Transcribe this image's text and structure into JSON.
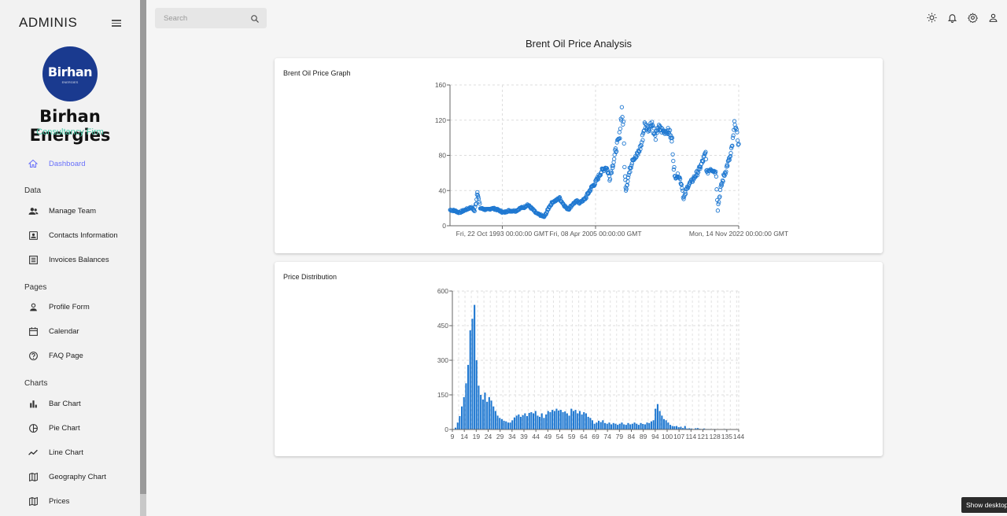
{
  "sidebar": {
    "brand": "ADMINIS",
    "logo_text": "Birhan",
    "logo_sub": "ENERGIES",
    "company_name": "Birhan Energies",
    "company_sub": "Consultancy Firm",
    "dashboard": {
      "label": "Dashboard",
      "icon": "home-icon"
    },
    "sections": {
      "data": "Data",
      "pages": "Pages",
      "charts": "Charts"
    },
    "items": {
      "manage_team": {
        "label": "Manage Team",
        "icon": "people-icon"
      },
      "contacts": {
        "label": "Contacts Information",
        "icon": "contacts-icon"
      },
      "invoices": {
        "label": "Invoices Balances",
        "icon": "receipt-icon"
      },
      "profile": {
        "label": "Profile Form",
        "icon": "person-icon"
      },
      "calendar": {
        "label": "Calendar",
        "icon": "calendar-icon"
      },
      "faq": {
        "label": "FAQ Page",
        "icon": "help-icon"
      },
      "bar": {
        "label": "Bar Chart",
        "icon": "bar-chart-icon"
      },
      "pie": {
        "label": "Pie Chart",
        "icon": "pie-chart-icon"
      },
      "line": {
        "label": "Line Chart",
        "icon": "line-chart-icon"
      },
      "geo": {
        "label": "Geography Chart",
        "icon": "map-icon"
      },
      "prices": {
        "label": "Prices",
        "icon": "map-icon"
      }
    }
  },
  "topbar": {
    "search_placeholder": "Search"
  },
  "page": {
    "title": "Brent Oil Price Analysis"
  },
  "taskbar": {
    "show_desktop": "Show desktop"
  },
  "colors": {
    "accent": "#6870fa",
    "brand_green": "#4cceac",
    "series": "#1f78d1",
    "logo_bg": "#1a3a8f"
  },
  "chart_data": [
    {
      "type": "scatter",
      "title": "Brent Oil Price Graph",
      "x_tick_labels": [
        "Fri, 22 Oct 1993 00:00:00 GMT",
        "Fri, 08 Apr 2005 00:00:00 GMT",
        "Mon, 14 Nov 2022 00:00:00 GMT"
      ],
      "x_ticks": [
        1993.81,
        2005.27,
        2022.87
      ],
      "xlim": [
        1987.38,
        2022.87
      ],
      "ylim": [
        0,
        160
      ],
      "y_ticks": [
        0,
        40,
        80,
        120,
        160
      ],
      "grid": true,
      "series": [
        {
          "x": [
            1987.4,
            1988.0,
            1988.5,
            1989.0,
            1989.5,
            1990.0,
            1990.4,
            1990.6,
            1990.75,
            1990.9,
            1991.1,
            1991.5,
            1992.0,
            1992.5,
            1993.0,
            1993.5,
            1994.0,
            1994.5,
            1995.0,
            1995.5,
            1996.0,
            1996.5,
            1996.9,
            1997.5,
            1998.0,
            1998.5,
            1998.95,
            1999.3,
            1999.6,
            2000.0,
            2000.5,
            2000.8,
            2001.3,
            2001.7,
            2001.95,
            2002.5,
            2003.0,
            2003.3,
            2003.6,
            2004.0,
            2004.5,
            2004.8,
            2005.2,
            2005.6,
            2006.0,
            2006.6,
            2007.0,
            2007.5,
            2007.9,
            2008.2,
            2008.5,
            2008.7,
            2008.9,
            2009.0,
            2009.4,
            2009.8,
            2010.3,
            2010.9,
            2011.3,
            2011.8,
            2012.2,
            2012.6,
            2013.0,
            2013.6,
            2014.3,
            2014.7,
            2015.0,
            2015.5,
            2015.9,
            2016.1,
            2016.6,
            2017.2,
            2017.9,
            2018.3,
            2018.8,
            2018.95,
            2019.4,
            2019.9,
            2020.1,
            2020.3,
            2020.6,
            2021.0,
            2021.5,
            2021.9,
            2022.2,
            2022.4,
            2022.6,
            2022.87
          ],
          "y": [
            18,
            17,
            15,
            17,
            19,
            21,
            17,
            27,
            40,
            30,
            20,
            19,
            18,
            20,
            19,
            17,
            15,
            17,
            17,
            17,
            20,
            21,
            24,
            19,
            14,
            12,
            10,
            16,
            22,
            27,
            29,
            32,
            25,
            20,
            19,
            25,
            28,
            26,
            28,
            31,
            39,
            44,
            48,
            55,
            62,
            67,
            55,
            74,
            92,
            100,
            133,
            110,
            55,
            42,
            60,
            76,
            78,
            92,
            115,
            110,
            118,
            100,
            112,
            107,
            108,
            95,
            55,
            58,
            45,
            30,
            45,
            52,
            62,
            70,
            82,
            60,
            65,
            62,
            60,
            20,
            40,
            55,
            70,
            80,
            100,
            120,
            105,
            93
          ]
        }
      ]
    },
    {
      "type": "bar",
      "title": "Price Distribution",
      "categories": [
        "9",
        "14",
        "19",
        "24",
        "29",
        "34",
        "39",
        "44",
        "49",
        "54",
        "59",
        "64",
        "69",
        "74",
        "79",
        "84",
        "89",
        "94",
        "100",
        "107",
        "114",
        "121",
        "128",
        "135",
        "144"
      ],
      "xlim": [
        9,
        144
      ],
      "ylim": [
        0,
        600
      ],
      "y_ticks": [
        0,
        150,
        300,
        450,
        600
      ],
      "grid": true,
      "bin_start": [
        9,
        10,
        11,
        12,
        13,
        14,
        15,
        16,
        17,
        18,
        19,
        20,
        21,
        22,
        23,
        24,
        25,
        26,
        27,
        28,
        29,
        30,
        31,
        32,
        33,
        34,
        35,
        36,
        37,
        38,
        39,
        40,
        41,
        42,
        43,
        44,
        45,
        46,
        47,
        48,
        49,
        50,
        51,
        52,
        53,
        54,
        55,
        56,
        57,
        58,
        59,
        60,
        61,
        62,
        63,
        64,
        65,
        66,
        67,
        68,
        69,
        70,
        71,
        72,
        73,
        74,
        75,
        76,
        77,
        78,
        79,
        80,
        81,
        82,
        83,
        84,
        85,
        86,
        87,
        88,
        89,
        90,
        91,
        92,
        93,
        94,
        95,
        96,
        97,
        98,
        99,
        100,
        101,
        102,
        103,
        104,
        105,
        106,
        107,
        108,
        109,
        110,
        111,
        112,
        113,
        114,
        115,
        116,
        117,
        118,
        119,
        120,
        121,
        122,
        123,
        124,
        125,
        126,
        127,
        128,
        129,
        130,
        131,
        132,
        133,
        134,
        135,
        136,
        137,
        138,
        139,
        140,
        141,
        142,
        143
      ],
      "values": [
        2,
        8,
        30,
        58,
        100,
        140,
        200,
        280,
        430,
        480,
        540,
        300,
        190,
        150,
        130,
        160,
        120,
        140,
        125,
        100,
        80,
        60,
        50,
        45,
        38,
        35,
        30,
        30,
        40,
        52,
        60,
        65,
        55,
        62,
        70,
        58,
        72,
        75,
        70,
        80,
        60,
        55,
        70,
        50,
        65,
        80,
        75,
        85,
        80,
        90,
        82,
        85,
        75,
        78,
        70,
        60,
        90,
        80,
        85,
        70,
        80,
        65,
        75,
        70,
        55,
        50,
        40,
        25,
        30,
        38,
        32,
        40,
        28,
        25,
        30,
        22,
        28,
        25,
        20,
        25,
        30,
        22,
        20,
        28,
        22,
        25,
        30,
        25,
        20,
        28,
        24,
        22,
        30,
        28,
        35,
        40,
        90,
        110,
        80,
        60,
        45,
        40,
        30,
        20,
        15,
        14,
        15,
        10,
        12,
        6,
        15,
        4,
        5,
        4,
        2,
        5,
        6,
        3,
        2,
        4,
        2,
        2,
        2,
        1,
        2,
        1,
        1,
        1,
        1,
        2,
        1,
        1,
        1,
        1,
        1,
        1
      ]
    }
  ]
}
